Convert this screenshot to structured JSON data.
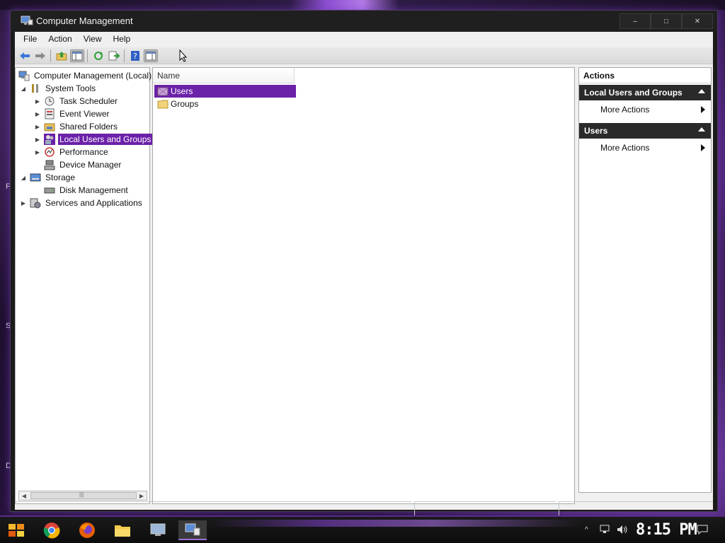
{
  "window": {
    "title": "Computer Management",
    "controls": {
      "minimize": "–",
      "maximize": "□",
      "close": "✕"
    }
  },
  "menu": [
    "File",
    "Action",
    "View",
    "Help"
  ],
  "toolbar": {
    "buttons": [
      "back-icon",
      "forward-icon",
      "up-folder-icon",
      "show-hide-tree-icon",
      "refresh-icon",
      "export-list-icon",
      "help-icon",
      "show-action-pane-icon"
    ]
  },
  "tree": {
    "root": "Computer Management (Local)",
    "items": [
      {
        "label": "System Tools",
        "expanded": true
      },
      {
        "label": "Task Scheduler"
      },
      {
        "label": "Event Viewer"
      },
      {
        "label": "Shared Folders"
      },
      {
        "label": "Local Users and Groups",
        "selected": true
      },
      {
        "label": "Performance"
      },
      {
        "label": "Device Manager"
      },
      {
        "label": "Storage",
        "expanded": true
      },
      {
        "label": "Disk Management"
      },
      {
        "label": "Services and Applications"
      }
    ]
  },
  "list": {
    "column": "Name",
    "rows": [
      {
        "label": "Users",
        "selected": true
      },
      {
        "label": "Groups"
      }
    ]
  },
  "actions": {
    "title": "Actions",
    "sections": [
      {
        "header": "Local Users and Groups",
        "item": "More Actions"
      },
      {
        "header": "Users",
        "item": "More Actions"
      }
    ]
  },
  "taskbar": {
    "clock": "8:15 PM",
    "apps": [
      "start-icon",
      "chrome-icon",
      "firefox-icon",
      "file-explorer-icon",
      "system-icon",
      "computer-management-icon"
    ]
  },
  "colors": {
    "selection": "#6b21a8",
    "action_header": "#2a2a2a",
    "accent": "#9b6fd6"
  }
}
